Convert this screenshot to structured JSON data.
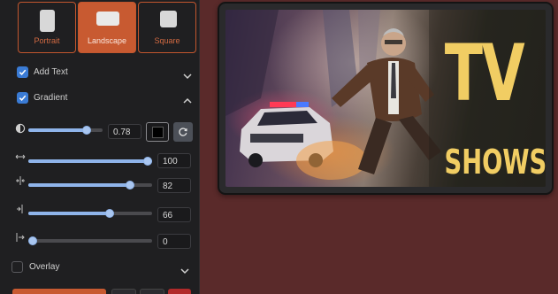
{
  "orientation": {
    "options": [
      {
        "label": "Portrait"
      },
      {
        "label": "Landscape"
      },
      {
        "label": "Square"
      }
    ],
    "selected": "Landscape"
  },
  "add_text": {
    "label": "Add Text",
    "checked": true
  },
  "gradient": {
    "label": "Gradient",
    "checked": true,
    "opacity": {
      "value": "0.78",
      "fraction": 0.78
    },
    "color": "#000000",
    "sliders": [
      {
        "icon": "horizontal-arrows-icon",
        "value": "100",
        "fraction": 1.0
      },
      {
        "icon": "split-center-icon",
        "value": "82",
        "fraction": 0.82
      },
      {
        "icon": "offset-left-icon",
        "value": "66",
        "fraction": 0.66
      },
      {
        "icon": "align-left-arrow-icon",
        "value": "0",
        "fraction": 0.0
      }
    ]
  },
  "overlay": {
    "label": "Overlay",
    "checked": false
  },
  "preview": {
    "title": "TV",
    "subtitle": "SHOWS",
    "text_color": "#f1cd63"
  },
  "colors": {
    "accent": "#c85a31",
    "checkbox": "#3a7bd5",
    "slider": "#8fb4ea",
    "background": "#5a2a2a"
  }
}
